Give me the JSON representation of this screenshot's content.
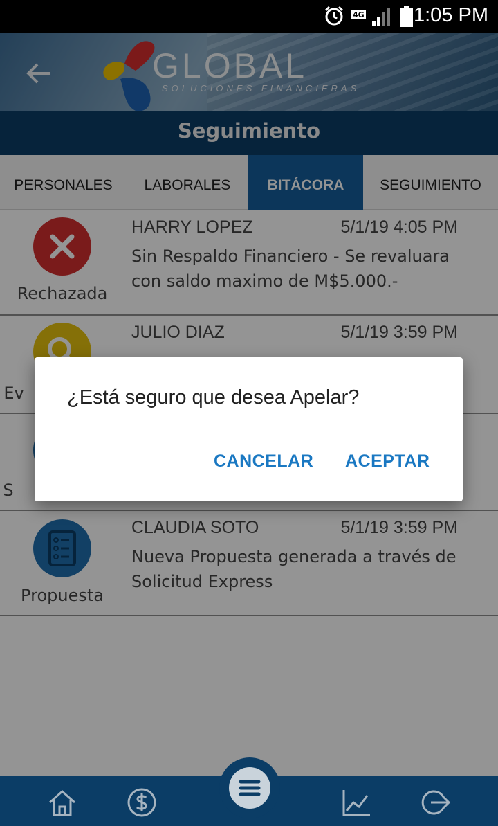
{
  "status_bar": {
    "time": "1:05 PM",
    "network": "4G"
  },
  "header": {
    "logo_text": "GLOBAL",
    "logo_sub": "SOLUCIONES FINANCIERAS"
  },
  "title": "Seguimiento",
  "tabs": [
    {
      "label": "PERSONALES"
    },
    {
      "label": "LABORALES"
    },
    {
      "label": "BITÁCORA"
    },
    {
      "label": "SEGUIMIENTO"
    }
  ],
  "entries": [
    {
      "status": "Rechazada",
      "name": "HARRY LOPEZ",
      "date": "5/1/19 4:05 PM",
      "description": "Sin Respaldo Financiero - Se revaluara con saldo maximo de M$5.000.-",
      "icon": "close-icon",
      "color": "#d32f2f"
    },
    {
      "status": "Ev",
      "name": "JULIO DIAZ",
      "date": "5/1/19 3:59 PM",
      "description": "",
      "icon": "search-icon",
      "color": "#e6c20e"
    },
    {
      "status": "S",
      "name": "",
      "date": "",
      "description": "",
      "icon": "document-icon",
      "color": "#1f6fae"
    },
    {
      "status": "Propuesta",
      "name": "CLAUDIA SOTO",
      "date": "5/1/19 3:59 PM",
      "description": "Nueva Propuesta generada a través de Solicitud Express",
      "icon": "list-icon",
      "color": "#1f6fae"
    }
  ],
  "dialog": {
    "message": "¿Está seguro que desea Apelar?",
    "cancel_label": "CANCELAR",
    "accept_label": "ACEPTAR"
  },
  "bottom_nav": [
    "home-icon",
    "dollar-icon",
    "menu-icon",
    "chart-icon",
    "logout-icon"
  ],
  "colors": {
    "primary": "#0b3d66",
    "active_tab": "#155d9c",
    "dialog_button": "#1a78c2",
    "rejected": "#d32f2f"
  }
}
